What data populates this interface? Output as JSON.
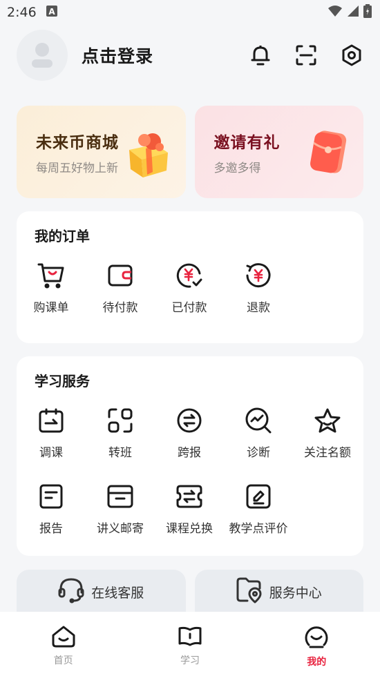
{
  "status_bar": {
    "time": "2:46"
  },
  "header": {
    "login_text": "点击登录"
  },
  "promos": [
    {
      "title": "未来币商城",
      "subtitle": "每周五好物上新"
    },
    {
      "title": "邀请有礼",
      "subtitle": "多邀多得"
    }
  ],
  "orders": {
    "title": "我的订单",
    "items": [
      {
        "label": "购课单",
        "icon": "cart-icon"
      },
      {
        "label": "待付款",
        "icon": "wallet-icon"
      },
      {
        "label": "已付款",
        "icon": "paid-icon"
      },
      {
        "label": "退款",
        "icon": "refund-icon"
      }
    ]
  },
  "services": {
    "title": "学习服务",
    "items": [
      {
        "label": "调课",
        "icon": "reschedule-icon"
      },
      {
        "label": "转班",
        "icon": "transfer-class-icon"
      },
      {
        "label": "跨报",
        "icon": "cross-enroll-icon"
      },
      {
        "label": "诊断",
        "icon": "diagnosis-icon"
      },
      {
        "label": "关注名额",
        "icon": "star-icon"
      },
      {
        "label": "报告",
        "icon": "report-icon"
      },
      {
        "label": "讲义邮寄",
        "icon": "mail-box-icon"
      },
      {
        "label": "课程兑换",
        "icon": "exchange-ticket-icon"
      },
      {
        "label": "教学点评价",
        "icon": "review-icon"
      }
    ]
  },
  "bottom_buttons": [
    {
      "label": "在线客服",
      "icon": "headset-icon"
    },
    {
      "label": "服务中心",
      "icon": "service-center-icon"
    }
  ],
  "tabbar": {
    "tabs": [
      {
        "label": "首页",
        "icon": "home-face-icon"
      },
      {
        "label": "学习",
        "icon": "book-icon"
      },
      {
        "label": "我的",
        "icon": "me-face-icon"
      }
    ],
    "active": "我的"
  },
  "colors": {
    "accent": "#e8233f",
    "icon_stroke": "#1a1a1a"
  }
}
